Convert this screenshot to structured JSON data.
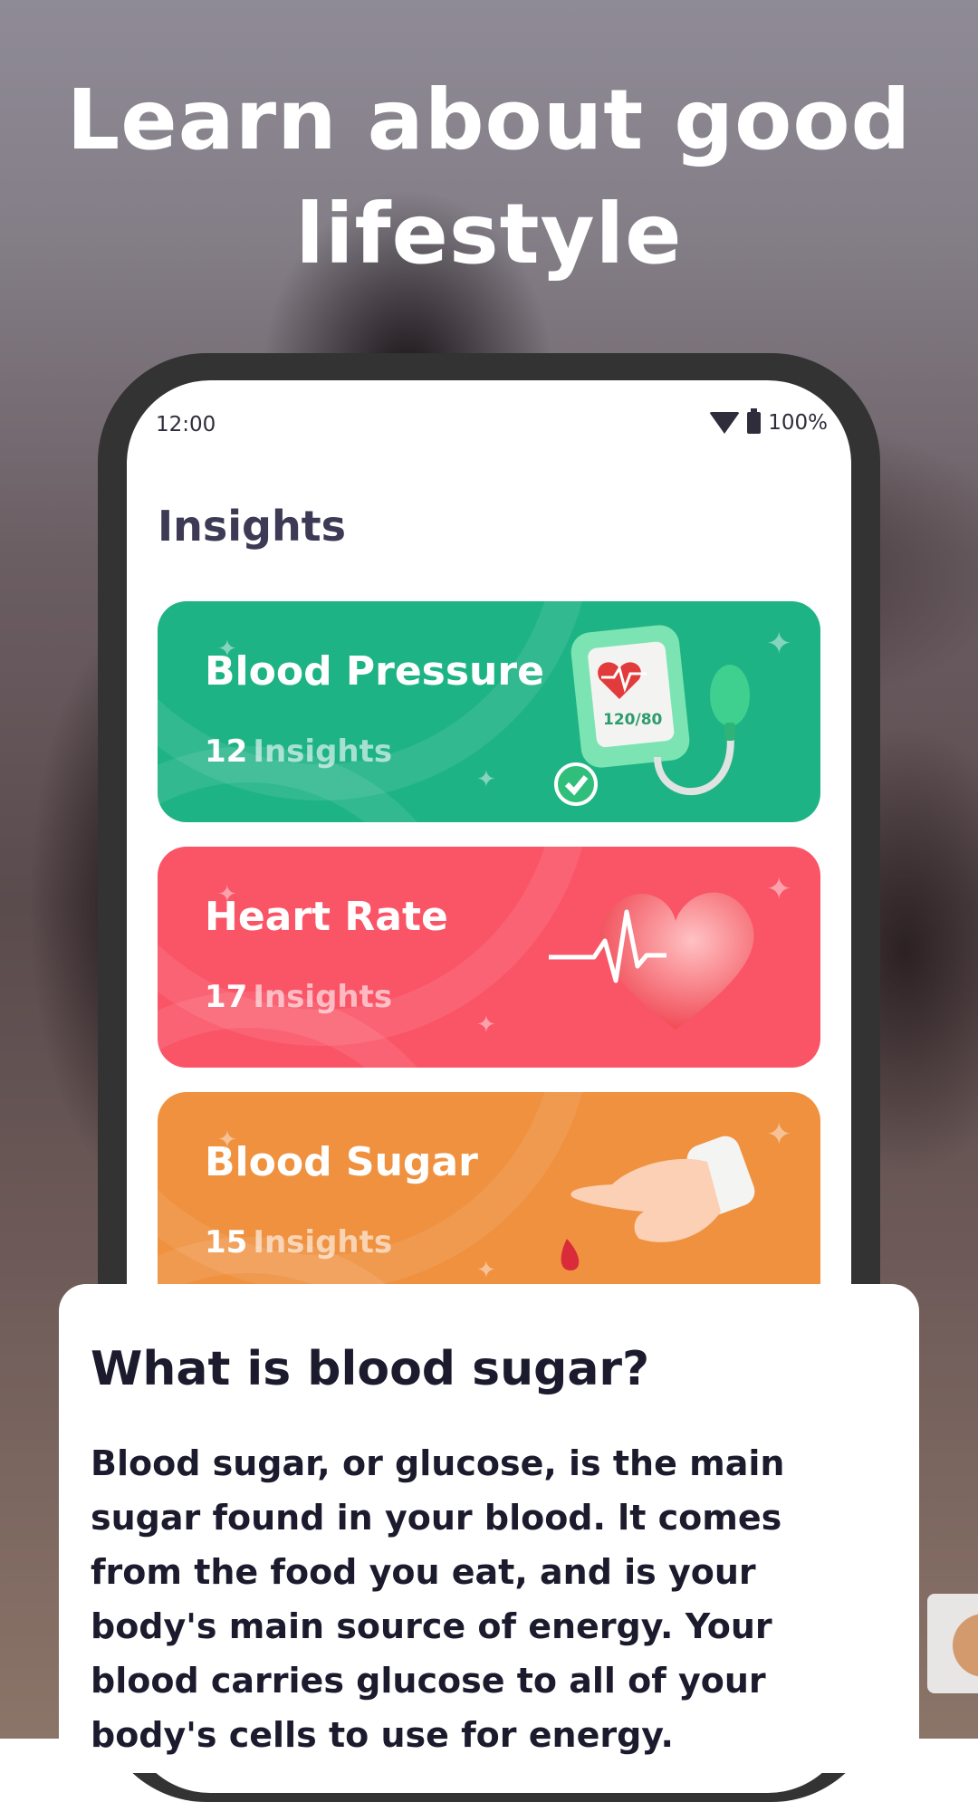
{
  "headline": "Learn about good lifestyle",
  "status_bar": {
    "time": "12:00",
    "battery": "100%"
  },
  "screen": {
    "title": "Insights",
    "cards": [
      {
        "title": "Blood Pressure",
        "count": "12",
        "count_label": "Insights",
        "color": "#1eb384",
        "icon": "blood-pressure-monitor-icon",
        "monitor_reading": "120/80"
      },
      {
        "title": "Heart Rate",
        "count": "17",
        "count_label": "Insights",
        "color": "#fa5467",
        "icon": "heart-pulse-icon"
      },
      {
        "title": "Blood Sugar",
        "count": "15",
        "count_label": "Insights",
        "color": "#ef913f",
        "icon": "finger-blood-drop-icon"
      }
    ]
  },
  "sheet": {
    "title": "What is blood sugar?",
    "body": "Blood sugar, or glucose, is the main sugar found in your blood. lt comes from the food you eat, and is your body's main source of energy. Your blood carries glucose to all of your body's cells to use for energy."
  }
}
